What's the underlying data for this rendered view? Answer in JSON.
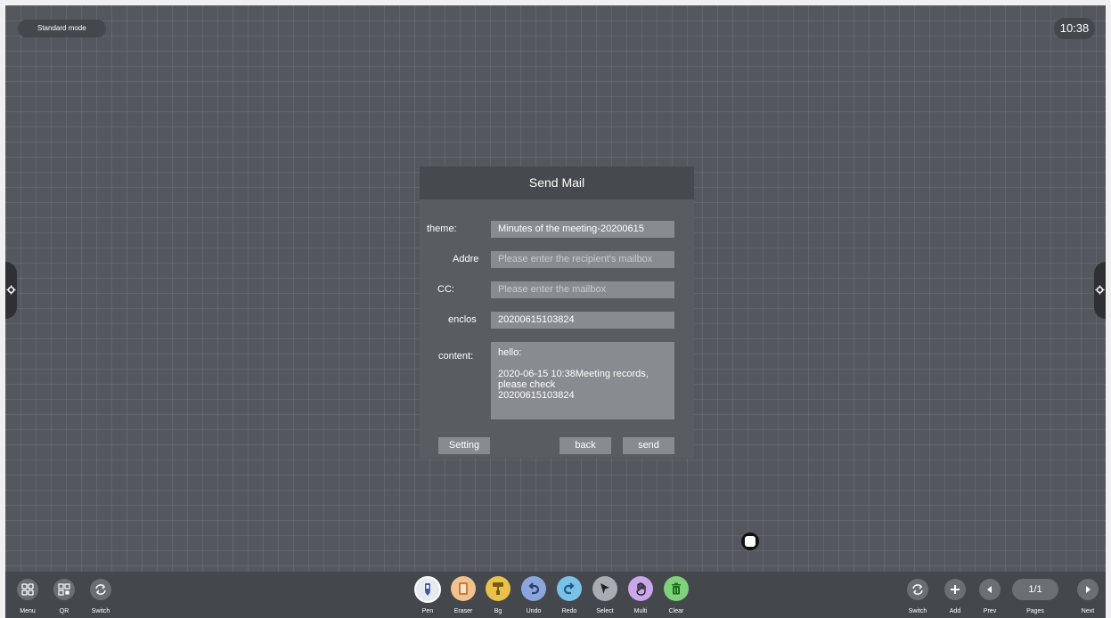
{
  "status": {
    "mode": "Standard mode",
    "time": "10:38"
  },
  "dialog": {
    "title": "Send Mail",
    "fields": {
      "theme": {
        "label": "theme:",
        "value": "Minutes of the meeting-20200615"
      },
      "address": {
        "label": "Addre",
        "placeholder": "Please enter the recipient's mailbox"
      },
      "cc": {
        "label": "CC:",
        "placeholder": "Please enter the mailbox"
      },
      "enclosure": {
        "label": "enclos",
        "value": "20200615103824"
      },
      "content": {
        "label": "content:",
        "greeting": "hello:",
        "line1": "2020-06-15 10:38Meeting records,",
        "line2": "please check",
        "line3": "20200615103824"
      }
    },
    "buttons": {
      "setting": "Setting",
      "back": "back",
      "send": "send"
    }
  },
  "toolbar": {
    "left": [
      {
        "label": "Menu",
        "icon": "grid-icon"
      },
      {
        "label": "QR",
        "icon": "qr-icon"
      },
      {
        "label": "Switch",
        "icon": "switch-icon"
      }
    ],
    "tools": [
      {
        "label": "Pen",
        "icon": "pen-icon",
        "color": "#e8eaf2"
      },
      {
        "label": "Eraser",
        "icon": "eraser-icon",
        "color": "#f3c28c"
      },
      {
        "label": "Bg",
        "icon": "paint-roller-icon",
        "color": "#e8c24a"
      },
      {
        "label": "Undo",
        "icon": "undo-icon",
        "color": "#8aa6dc"
      },
      {
        "label": "Redo",
        "icon": "redo-icon",
        "color": "#7ac1e8"
      },
      {
        "label": "Select",
        "icon": "cursor-icon",
        "color": "#a9acb3"
      },
      {
        "label": "Multi",
        "icon": "multi-touch-icon",
        "color": "#c9a7ea"
      },
      {
        "label": "Clear",
        "icon": "trash-icon",
        "color": "#7fd17c"
      }
    ],
    "right": [
      {
        "label": "Switch",
        "icon": "switch-icon"
      },
      {
        "label": "Add",
        "icon": "plus-icon"
      },
      {
        "label": "Prev",
        "icon": "prev-icon"
      },
      {
        "label": "Pages",
        "value": "1/1"
      },
      {
        "label": "Next",
        "icon": "next-icon"
      }
    ]
  }
}
